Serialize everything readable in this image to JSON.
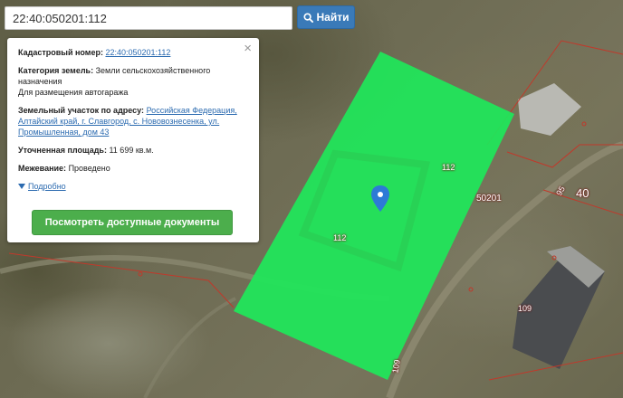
{
  "search": {
    "value": "22:40:050201:112",
    "button_label": "Найти"
  },
  "info_panel": {
    "cadastral_label": "Кадастровый номер:",
    "cadastral_value": "22:40:050201:112",
    "category_label": "Категория земель:",
    "category_value": "Земли сельскохозяйственного назначения",
    "usage_value": "Для размещения автогаража",
    "address_label": "Земельный участок по адресу:",
    "address_value": "Российская Федерация, Алтайский край, г. Славгород, с. Нововознесенка, ул. Промышленная, дом 43",
    "area_label": "Уточненная площадь:",
    "area_value": "11 699 кв.м.",
    "survey_label": "Межевание:",
    "survey_value": "Проведено",
    "details_label": "Подробно",
    "docs_button_label": "Посмотреть доступные документы",
    "close_symbol": "×"
  },
  "map_labels": {
    "parcel_112_a": "112",
    "parcel_112_b": "112",
    "block_50201": "50201",
    "parcel_95": "95",
    "parcel_40": "40",
    "parcel_109_a": "109",
    "parcel_109_b": "109"
  },
  "colors": {
    "parcel_fill": "#1ee85a",
    "boundary": "#c0392b",
    "marker": "#2d7ad6",
    "search_button": "#3a7ab8",
    "docs_button": "#4cae4c"
  }
}
